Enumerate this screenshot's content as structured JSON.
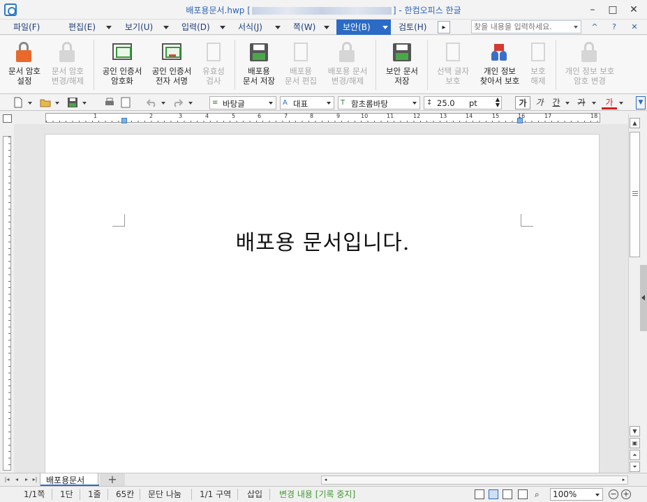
{
  "window": {
    "title_prefix": "배포용문서.hwp [",
    "title_suffix": "] - 한컴오피스 한글",
    "minimize": "–",
    "maximize": "□",
    "close": "✕"
  },
  "menu": {
    "items": [
      {
        "label": "파일(F)"
      },
      {
        "label": "편집(E)"
      },
      {
        "label": "보기(U)"
      },
      {
        "label": "입력(D)"
      },
      {
        "label": "서식(J)"
      },
      {
        "label": "쪽(W)"
      },
      {
        "label": "보안(B)"
      },
      {
        "label": "검토(H)"
      }
    ],
    "search_placeholder": "찾을 내용을 입력하세요.",
    "collapse": "^",
    "help": "?",
    "close": "✕"
  },
  "ribbon": {
    "buttons": [
      {
        "label": "문서 암호\n설정",
        "enabled": true,
        "icon": "lock-icon"
      },
      {
        "label": "문서 암호\n변경/해제",
        "enabled": false,
        "icon": "lock-icon"
      },
      {
        "label": "공인 인증서\n암호화",
        "enabled": true,
        "icon": "certificate-icon"
      },
      {
        "label": "공인 인증서\n전자 서명",
        "enabled": true,
        "icon": "certificate-sign-icon"
      },
      {
        "label": "유효성\n검사",
        "enabled": false,
        "icon": "validate-icon"
      },
      {
        "label": "배포용\n문서 저장",
        "enabled": true,
        "icon": "save-icon"
      },
      {
        "label": "배포용\n문서 편집",
        "enabled": false,
        "icon": "edit-icon"
      },
      {
        "label": "배포용 문서\n변경/해제",
        "enabled": false,
        "icon": "lock-icon"
      },
      {
        "label": "보안 문서\n저장",
        "enabled": true,
        "icon": "secure-save-icon"
      },
      {
        "label": "선택 글자\n보호",
        "enabled": false,
        "icon": "protect-text-icon"
      },
      {
        "label": "개인 정보\n찾아서 보호",
        "enabled": true,
        "icon": "privacy-find-icon"
      },
      {
        "label": "보호\n해제",
        "enabled": false,
        "icon": "unprotect-icon"
      },
      {
        "label": "개인 정보 보호\n암호 변경",
        "enabled": false,
        "icon": "lock-icon"
      }
    ]
  },
  "format_toolbar": {
    "style": "바탕글",
    "language": "대표",
    "font": "함초롬바탕",
    "size": "25.0",
    "unit": "pt",
    "bold": "가",
    "italic": "가",
    "underline": "간",
    "strike": "가",
    "color": "가"
  },
  "ruler": {
    "numbers": [
      "1",
      "2",
      "3",
      "4",
      "5",
      "6",
      "7",
      "8",
      "9",
      "10",
      "11",
      "12",
      "13",
      "14",
      "15",
      "16",
      "17",
      "18"
    ]
  },
  "document": {
    "text": "배포용 문서입니다."
  },
  "tabs": {
    "doc_name": "배포용문서",
    "add": "+"
  },
  "status": {
    "page": "1/1쪽",
    "column": "1단",
    "line": "1줄",
    "position": "65칸",
    "paragraph": "문단 나눔",
    "section": "1/1 구역",
    "insert_mode": "삽입",
    "track_changes": "변경 내용 [기록 중지]",
    "zoom": "100%"
  },
  "colors": {
    "accent": "#2b6bc6",
    "title": "#2a62b8",
    "status_green": "#3c9b2a"
  }
}
